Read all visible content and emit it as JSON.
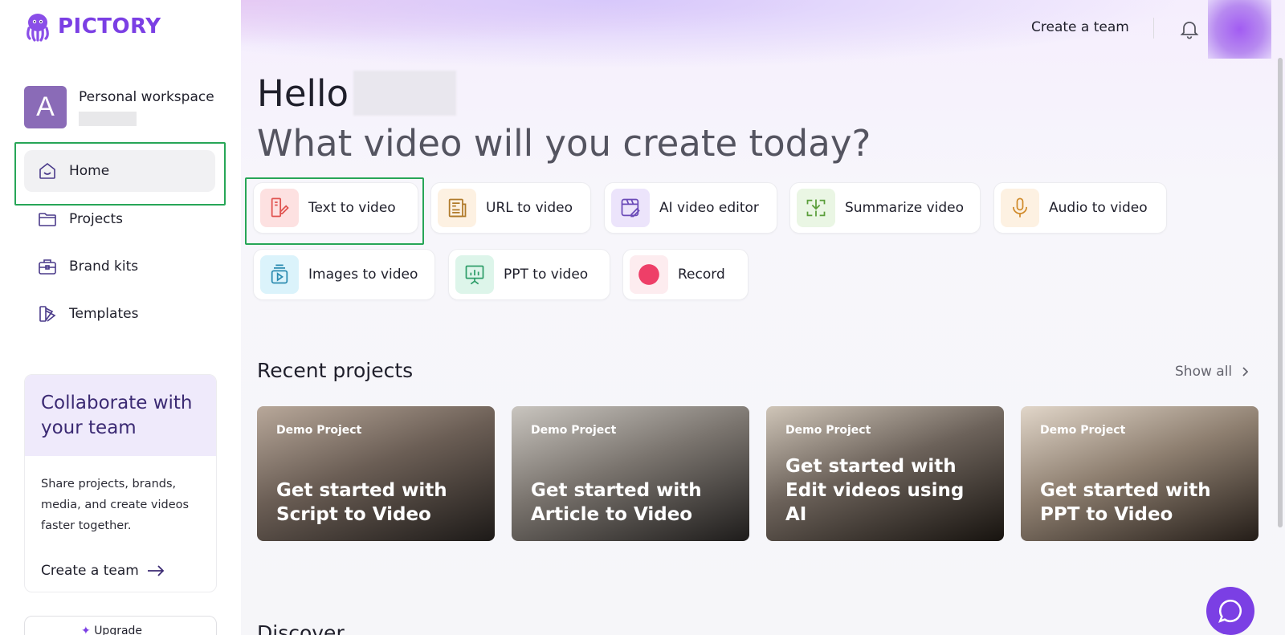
{
  "brand": {
    "name": "PICTORY",
    "color": "#7b3fe4"
  },
  "workspace": {
    "initial": "A",
    "name": "Personal workspace"
  },
  "sidebar": {
    "items": [
      {
        "label": "Home",
        "icon": "home-icon",
        "active": true
      },
      {
        "label": "Projects",
        "icon": "folder-icon"
      },
      {
        "label": "Brand kits",
        "icon": "briefcase-icon"
      },
      {
        "label": "Templates",
        "icon": "templates-icon"
      }
    ]
  },
  "collab": {
    "title": "Collaborate with your team",
    "body": "Share projects, brands, media, and create videos faster together.",
    "link": "Create a team",
    "upgrade": "Upgrade"
  },
  "topbar": {
    "create_team": "Create a team"
  },
  "greeting": {
    "hello": "Hello",
    "subtitle": "What video will you create today?"
  },
  "actions": [
    {
      "label": "Text to video",
      "icon": "text-to-video-icon",
      "color": "#fde1e1"
    },
    {
      "label": "URL to video",
      "icon": "url-to-video-icon",
      "color": "#fdf1e2"
    },
    {
      "label": "AI video editor",
      "icon": "ai-video-editor-icon",
      "color": "#ece4fb"
    },
    {
      "label": "Summarize video",
      "icon": "summarize-video-icon",
      "color": "#eaf6e4"
    },
    {
      "label": "Audio to video",
      "icon": "microphone-icon",
      "color": "#fdf1e2"
    },
    {
      "label": "Images to video",
      "icon": "images-to-video-icon",
      "color": "#dbf3fb"
    },
    {
      "label": "PPT to video",
      "icon": "presentation-icon",
      "color": "#ddf5ea"
    },
    {
      "label": "Record",
      "icon": "record-icon",
      "color": "#fdecef"
    }
  ],
  "recent": {
    "title": "Recent projects",
    "show_all": "Show all",
    "cards": [
      {
        "tag": "Demo Project",
        "title": "Get started with Script to Video"
      },
      {
        "tag": "Demo Project",
        "title": "Get started with Article to Video"
      },
      {
        "tag": "Demo Project",
        "title": "Get started with Edit videos using AI"
      },
      {
        "tag": "Demo Project",
        "title": "Get started with PPT to Video"
      }
    ]
  },
  "discover": {
    "title": "Discover"
  }
}
